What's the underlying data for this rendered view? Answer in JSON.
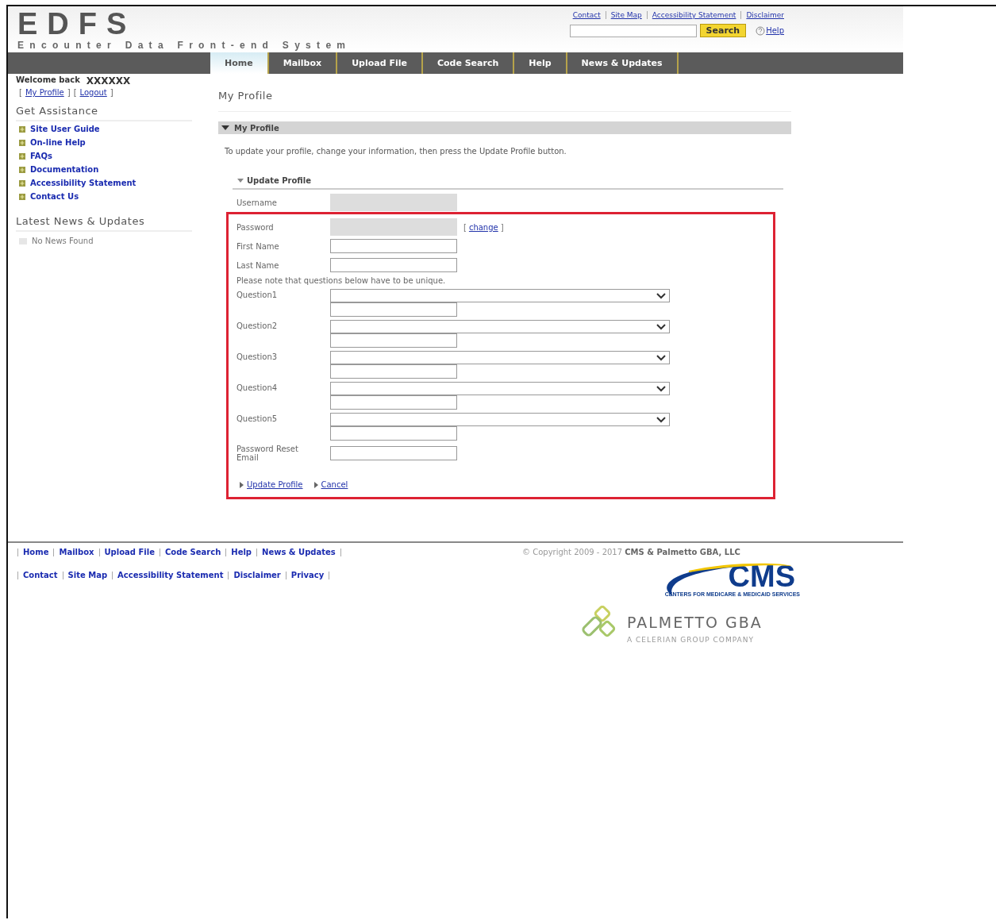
{
  "header": {
    "logo_title": "EDFS",
    "logo_subtitle": "Encounter Data Front-end System",
    "top_links": [
      "Contact",
      "Site Map",
      "Accessibility Statement",
      "Disclaimer"
    ],
    "search": {
      "button": "Search"
    },
    "help_link": "Help"
  },
  "nav_tabs": [
    {
      "label": "Home",
      "selected": true
    },
    {
      "label": "Mailbox",
      "selected": false
    },
    {
      "label": "Upload File",
      "selected": false
    },
    {
      "label": "Code Search",
      "selected": false
    },
    {
      "label": "Help",
      "selected": false
    },
    {
      "label": "News & Updates",
      "selected": false
    }
  ],
  "sidebar": {
    "welcome_label": "Welcome back",
    "user_name": "XXXXXX",
    "account_links": [
      {
        "open": "[",
        "label": "My Profile",
        "close": "]"
      },
      {
        "open": "[",
        "label": "Logout",
        "close": "]"
      }
    ],
    "assistance_title": "Get Assistance",
    "assistance_links": [
      "Site User Guide",
      "On-line Help",
      "FAQs",
      "Documentation",
      "Accessibility Statement",
      "Contact Us"
    ],
    "news_title": "Latest News & Updates",
    "news_items": [
      "No News Found"
    ]
  },
  "main": {
    "page_title": "My Profile",
    "section_title": "My Profile",
    "intro": "To update your profile, change your information, then press the Update Profile button.",
    "form_title": "Update Profile",
    "fields": [
      {
        "kind": "text",
        "label": "Username",
        "disabled": true
      }
    ],
    "highlighted_fields": [
      {
        "kind": "text",
        "label": "Password",
        "disabled": true,
        "link": {
          "open": "[",
          "label": "change",
          "close": "]"
        }
      },
      {
        "kind": "text",
        "label": "First Name",
        "disabled": false
      },
      {
        "kind": "text",
        "label": "Last Name",
        "disabled": false
      },
      {
        "kind": "note",
        "label": "Please note that questions below have to be unique."
      },
      {
        "kind": "question",
        "label": "Question1"
      },
      {
        "kind": "question",
        "label": "Question2"
      },
      {
        "kind": "question",
        "label": "Question3"
      },
      {
        "kind": "question",
        "label": "Question4"
      },
      {
        "kind": "question",
        "label": "Question5"
      },
      {
        "kind": "text",
        "label": "Password Reset Email",
        "disabled": false
      },
      {
        "kind": "actions",
        "links": [
          "Update Profile",
          "Cancel"
        ]
      }
    ]
  },
  "footer": {
    "nav_links": [
      "Home",
      "Mailbox",
      "Upload File",
      "Code Search",
      "Help",
      "News & Updates"
    ],
    "info_links": [
      "Contact",
      "Site Map",
      "Accessibility Statement",
      "Disclaimer",
      "Privacy"
    ],
    "copyright": "© Copyright 2009 - 2017 **CMS & Palmetto GBA, LLC**",
    "cms_logo": {
      "name": "CMS",
      "tagline": "CENTERS FOR MEDICARE & MEDICAID SERVICES"
    },
    "palmetto_logo": {
      "name": "PALMETTO GBA",
      "tagline": "A CELERIAN GROUP COMPANY"
    }
  }
}
